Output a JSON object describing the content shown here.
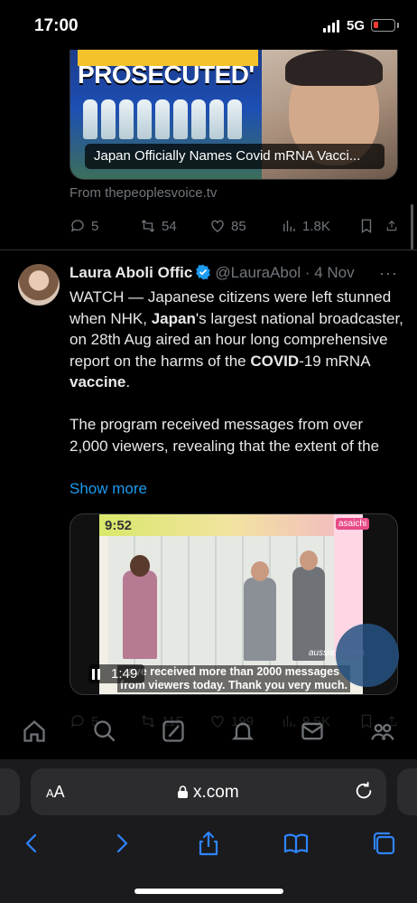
{
  "status_bar": {
    "time": "17:00",
    "network": "5G"
  },
  "prev_tweet": {
    "image_headline": "PROSECUTED'",
    "card_caption": "Japan Officially Names Covid mRNA Vacci...",
    "source": "From thepeoplesvoice.tv",
    "actions": {
      "replies": "5",
      "reposts": "54",
      "likes": "85",
      "views": "1.8K"
    }
  },
  "tweet": {
    "author_name": "Laura Aboli Offic",
    "handle_date": "@LauraAbol · 4 Nov",
    "more": "···",
    "body": {
      "p1_a": "WATCH — Japanese citizens were left stunned when NHK, ",
      "p1_b": "Japan",
      "p1_c": "'s largest national broadcaster, on 28th Aug aired an hour long comprehensive report on the harms of the ",
      "p1_d": "COVID",
      "p1_e": "-19 mRNA ",
      "p1_f": "vaccine",
      "p1_g": ".",
      "p2": "The program received messages from over 2,000 viewers, revealing that the extent of the"
    },
    "show_more": "Show more",
    "video": {
      "duration": "1:49",
      "clock": "9:52",
      "channel_tag": "asaichi",
      "watermark": "aussie17.com",
      "subtitle": "ave received more than 2000 messages from viewers today. Thank you very much."
    },
    "actions": {
      "replies": "5",
      "reposts": "115",
      "likes": "199",
      "views": "9.5K"
    }
  },
  "browser": {
    "aa_label_small": "A",
    "aa_label_large": "A",
    "url": "x.com"
  }
}
